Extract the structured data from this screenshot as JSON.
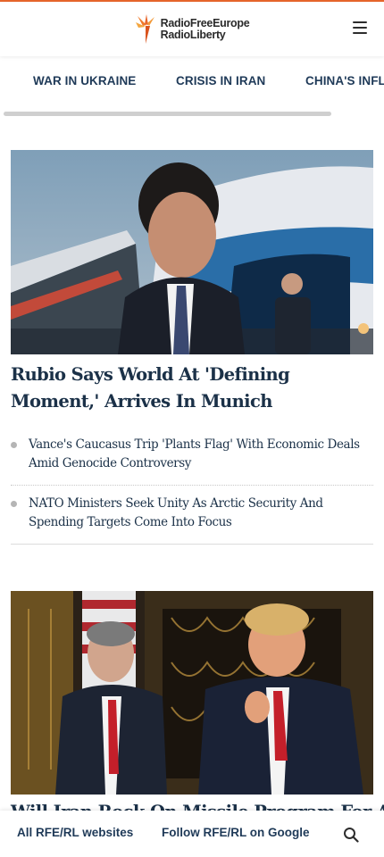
{
  "brand": {
    "name_line1": "RadioFreeEurope",
    "name_line2": "RadioLiberty",
    "accent_color": "#e8662b",
    "logo_icon": "rfe-torch-icon"
  },
  "header": {
    "menu_icon": "hamburger-menu-icon"
  },
  "nav": {
    "items": [
      {
        "label": "WAR IN UKRAINE"
      },
      {
        "label": "CRISIS IN IRAN"
      },
      {
        "label": "CHINA'S INFLU"
      }
    ],
    "text_color": "#1f3a58"
  },
  "articles": [
    {
      "headline": "Rubio Says World At 'Defining Moment,' Arrives In Munich",
      "related": [
        {
          "title": "Vance's Caucasus Trip 'Plants Flag' With Economic Deals Amid Genocide Controversy"
        },
        {
          "title": "NATO Ministers Seek Unity As Arctic Security And Spending Targets Come Into Focus"
        }
      ]
    },
    {
      "headline": "Will Iran Rock On Missile Program For A"
    }
  ],
  "bottom_bar": {
    "all_sites_label": "All RFE/RL websites",
    "google_label": "Follow RFE/RL on Google",
    "search_icon": "search-icon"
  }
}
